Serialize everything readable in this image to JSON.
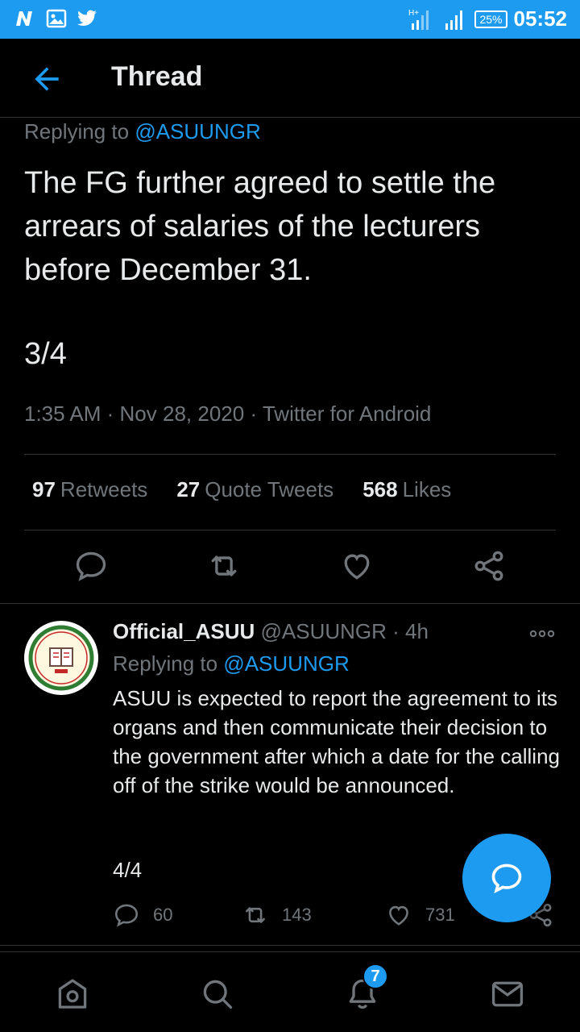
{
  "status_bar": {
    "time": "05:52",
    "battery": "25%",
    "notification_icons": [
      "n-logo-icon",
      "image-icon",
      "twitter-bird-icon"
    ]
  },
  "header": {
    "title": "Thread"
  },
  "main_tweet": {
    "replying_prefix": "Replying to",
    "replying_handle": "@ASUUNGR",
    "text": "The FG further agreed to settle the arrears of salaries of the lecturers before December 31.",
    "thread_index": "3/4",
    "time": "1:35 AM",
    "date": "Nov 28, 2020",
    "source": "Twitter for Android",
    "retweets_count": "97",
    "retweets_label": "Retweets",
    "quotes_count": "27",
    "quotes_label": "Quote Tweets",
    "likes_count": "568",
    "likes_label": "Likes"
  },
  "reply_tweet": {
    "name": "Official_ASUU",
    "handle": "@ASUUNGR",
    "age": "4h",
    "replying_prefix": "Replying to",
    "replying_handle": "@ASUUNGR",
    "text": "ASUU is expected to report the agreement to its organs and then communicate their decision to the government after which a date for the calling off of the strike would be announced.",
    "thread_index": "4/4",
    "replies": "60",
    "retweets": "143",
    "likes": "731"
  },
  "bottom_nav": {
    "notifications_badge": "7"
  },
  "colors": {
    "accent": "#1d9bf0",
    "background": "#000000",
    "muted_text": "#71767b",
    "divider": "#2f3336"
  }
}
